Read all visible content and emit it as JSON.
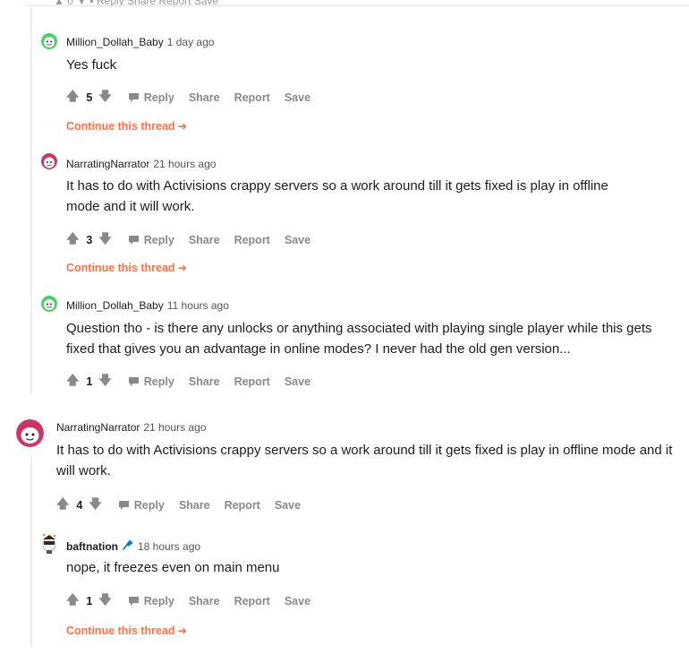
{
  "top_fragment": "▲ 0 ▼  ▪ Reply  Share  Report  Save",
  "actions_labels": {
    "reply": "Reply",
    "share": "Share",
    "report": "Report",
    "save": "Save"
  },
  "continue_label": "Continue this thread",
  "comments": [
    {
      "user": "Million_Dollah_Baby",
      "age": "1 day ago",
      "text": "Yes fuck",
      "score": "5",
      "avatar": "green-snoo"
    },
    {
      "user": "NarratingNarrator",
      "age": "21 hours ago",
      "text": "It has to do with Activisions crappy servers so a work around till it gets fixed is play in offline mode and it will work.",
      "score": "3",
      "avatar": "pink-snoo"
    },
    {
      "user": "Million_Dollah_Baby",
      "age": "11 hours ago",
      "text": "Question tho - is there any unlocks or anything associated with playing single player while this gets fixed that gives you an advantage in online modes? I never had the old gen version...",
      "score": "1",
      "avatar": "green-snoo"
    },
    {
      "user": "NarratingNarrator",
      "age": "21 hours ago",
      "text": "It has to do with Activisions crappy servers so a work around till it gets fixed is play in offline mode and it will work.",
      "score": "4",
      "avatar": "pink-snoo"
    },
    {
      "user": "baftnation",
      "age": "18 hours ago",
      "text": "nope, it freezes even on main menu",
      "score": "1",
      "avatar": "custom-avatar",
      "badge_icon": "microphone-icon"
    }
  ],
  "colors": {
    "accent_continue": "#ff7046",
    "meta": "#878a8c",
    "thread_line": "#edeff1",
    "mic": "#0079d3"
  }
}
